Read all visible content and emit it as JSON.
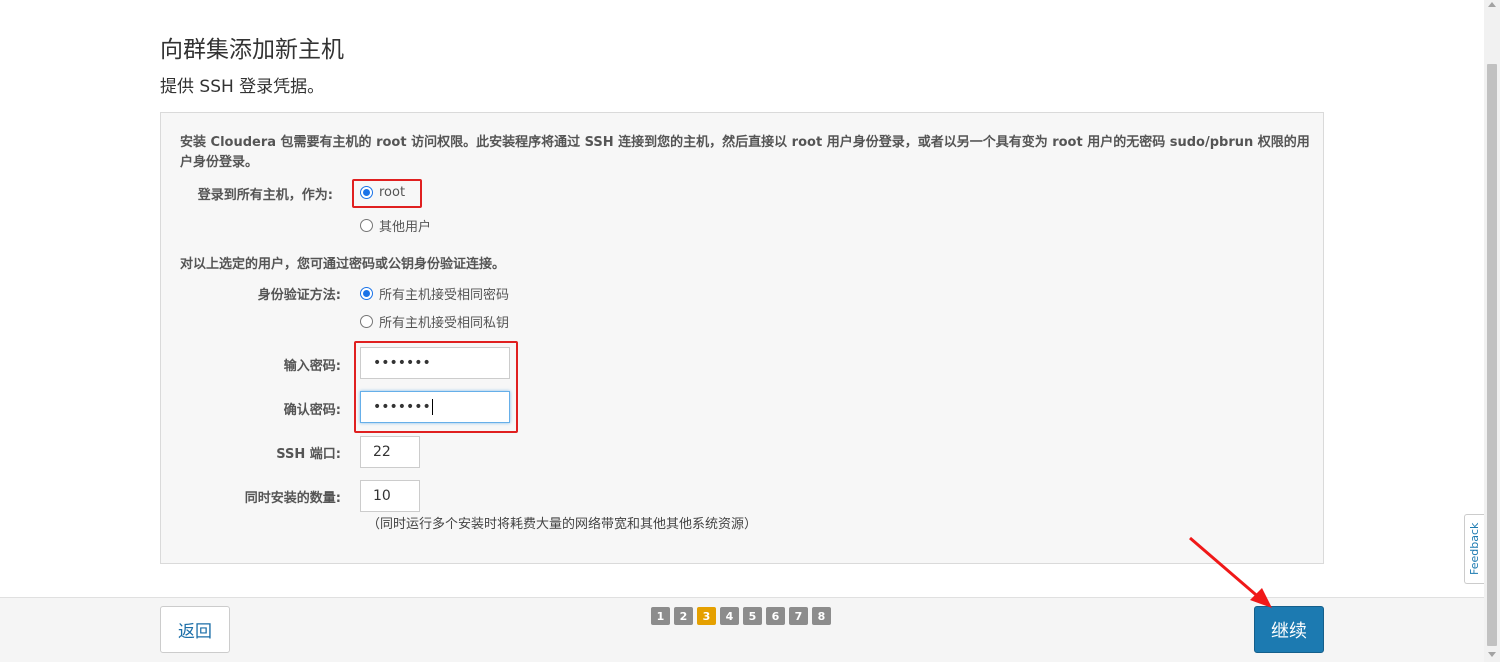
{
  "header": {
    "title": "向群集添加新主机",
    "subtitle": "提供 SSH 登录凭据。"
  },
  "panel": {
    "intro": "安装 Cloudera 包需要有主机的 root 访问权限。此安装程序将通过 SSH 连接到您的主机，然后直接以 root 用户身份登录，或者以另一个具有变为 root 用户的无密码 sudo/pbrun 权限的用户身份登录。",
    "login_label": "登录到所有主机，作为:",
    "login_options": [
      {
        "label": "root",
        "checked": true
      },
      {
        "label": "其他用户",
        "checked": false
      }
    ],
    "auth_hint": "对以上选定的用户，您可通过密码或公钥身份验证连接。",
    "auth_method_label": "身份验证方法:",
    "auth_options": [
      {
        "label": "所有主机接受相同密码",
        "checked": true
      },
      {
        "label": "所有主机接受相同私钥",
        "checked": false
      }
    ],
    "password_label": "输入密码:",
    "password_value": "•••••••",
    "confirm_label": "确认密码:",
    "confirm_value": "•••••••",
    "ssh_port_label": "SSH 端口:",
    "ssh_port_value": "22",
    "concurrent_label": "同时安装的数量:",
    "concurrent_value": "10",
    "concurrent_note": "（同时运行多个安装时将耗费大量的网络带宽和其他其他系统资源）"
  },
  "footer": {
    "back_label": "返回",
    "next_label": "继续",
    "steps": [
      "1",
      "2",
      "3",
      "4",
      "5",
      "6",
      "7",
      "8"
    ],
    "active_step": "3"
  },
  "feedback_label": "Feedback",
  "colors": {
    "primary": "#1c7ab1",
    "active_step": "#e5a000",
    "highlight": "#e02020"
  }
}
